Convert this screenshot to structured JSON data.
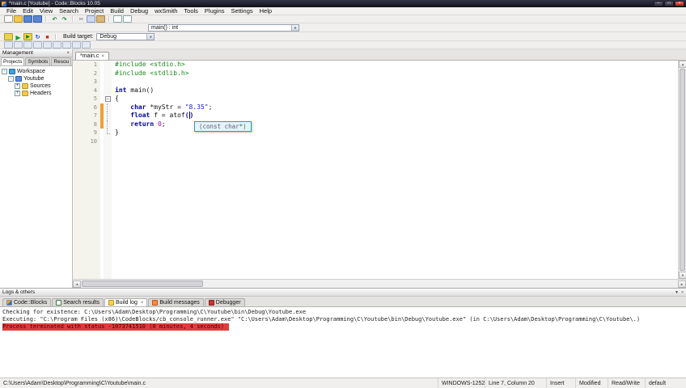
{
  "window": {
    "title": "*main.c [Youtube] - Code::Blocks 10.05"
  },
  "glyphs": {
    "minimize": "–",
    "maximize": "□",
    "close": "×",
    "close_small": "×",
    "dropdown": "▼",
    "left": "◄",
    "right": "►",
    "up": "▲",
    "down": "▼"
  },
  "menu": {
    "items": [
      "File",
      "Edit",
      "View",
      "Search",
      "Project",
      "Build",
      "Debug",
      "wxSmith",
      "Tools",
      "Plugins",
      "Settings",
      "Help"
    ]
  },
  "toolbar": {
    "row1_icons": [
      "new-file",
      "open",
      "save",
      "save-all",
      "|",
      "undo",
      "redo",
      "|",
      "cut",
      "copy",
      "paste",
      "|",
      "find",
      "replace"
    ],
    "symbol_combo": "main() : int",
    "build_icons": [
      "compile",
      "run",
      "build-and-run",
      "rebuild",
      "abort"
    ],
    "build_target_label": "Build target:",
    "build_target_value": "Debug",
    "debug_icons": [
      "debug",
      "run-to-cursor",
      "next-line",
      "step-into",
      "step-out",
      "next-instruction",
      "toggle-breakpoint",
      "debugging-windows",
      "various-info"
    ],
    "icon_glyphs": {
      "undo": "↶",
      "redo": "↷",
      "cut": "✂",
      "run": "▶",
      "build-and-run": "▶",
      "rebuild": "↻",
      "abort": "■"
    }
  },
  "management": {
    "title": "Management",
    "tabs": [
      {
        "label": "Projects",
        "active": true
      },
      {
        "label": "Symbols"
      },
      {
        "label": "Resou"
      }
    ],
    "tree": [
      {
        "label": "Workspace",
        "indent": 0,
        "expander": "-",
        "icon": "workspace"
      },
      {
        "label": "Youtube",
        "indent": 1,
        "expander": "-",
        "icon": "project"
      },
      {
        "label": "Sources",
        "indent": 2,
        "expander": "+",
        "icon": "folder"
      },
      {
        "label": "Headers",
        "indent": 2,
        "expander": "+",
        "icon": "folder"
      }
    ]
  },
  "editor": {
    "tab_label": "*main.c",
    "calltip": "(const char*)",
    "lines": [
      {
        "num": "1",
        "tokens": [
          {
            "t": "#include <stdio.h>",
            "c": "preproc"
          }
        ]
      },
      {
        "num": "2",
        "tokens": [
          {
            "t": "#include <stdlib.h>",
            "c": "preproc"
          }
        ]
      },
      {
        "num": "3",
        "tokens": []
      },
      {
        "num": "4",
        "tokens": [
          {
            "t": "int",
            "c": "keyword"
          },
          {
            "t": " main()",
            "c": "plain"
          }
        ]
      },
      {
        "num": "5",
        "fold": "minus",
        "tokens": [
          {
            "t": "{",
            "c": "plain"
          }
        ]
      },
      {
        "num": "6",
        "guide": "mid",
        "changed": true,
        "tokens": [
          {
            "t": "    ",
            "c": "plain"
          },
          {
            "t": "char",
            "c": "keyword"
          },
          {
            "t": " *myStr = ",
            "c": "plain"
          },
          {
            "t": "\"8.35\"",
            "c": "string"
          },
          {
            "t": ";",
            "c": "plain"
          }
        ]
      },
      {
        "num": "7",
        "guide": "mid",
        "changed": true,
        "tokens": [
          {
            "t": "    ",
            "c": "plain"
          },
          {
            "t": "float",
            "c": "keyword"
          },
          {
            "t": " f = atof",
            "c": "plain"
          },
          {
            "t": "(",
            "c": "brace"
          },
          {
            "t": "",
            "c": "cursor"
          },
          {
            "t": ")",
            "c": "brace"
          }
        ]
      },
      {
        "num": "8",
        "guide": "mid",
        "changed": true,
        "tokens": [
          {
            "t": "    ",
            "c": "plain"
          },
          {
            "t": "return",
            "c": "keyword"
          },
          {
            "t": " ",
            "c": "plain"
          },
          {
            "t": "0",
            "c": "number"
          },
          {
            "t": ";",
            "c": "plain"
          }
        ]
      },
      {
        "num": "9",
        "guide": "end",
        "tokens": [
          {
            "t": "}",
            "c": "plain"
          }
        ]
      },
      {
        "num": "10",
        "tokens": []
      }
    ]
  },
  "logs": {
    "title": "Logs & others",
    "tabs": [
      {
        "label": "Code::Blocks",
        "icon": "codeblocks"
      },
      {
        "label": "Search results",
        "icon": "search"
      },
      {
        "label": "Build log",
        "icon": "build-log",
        "active": true,
        "closable": true
      },
      {
        "label": "Build messages",
        "icon": "build-messages"
      },
      {
        "label": "Debugger",
        "icon": "debugger"
      }
    ],
    "lines": [
      {
        "style": "normal",
        "text": "Checking for existence: C:\\Users\\Adam\\Desktop\\Programming\\C\\Youtube\\bin\\Debug\\Youtube.exe"
      },
      {
        "style": "normal",
        "text": "Executing: \"C:\\Program Files (x86)\\CodeBlocks/cb_console_runner.exe\" \"C:\\Users\\Adam\\Desktop\\Programming\\C\\Youtube\\bin\\Debug\\Youtube.exe\"  (in C:\\Users\\Adam\\Desktop\\Programming\\C\\Youtube\\.)"
      },
      {
        "style": "error",
        "text": "Process terminated with status -1073741510 (0 minutes, 4 seconds)"
      }
    ]
  },
  "statusbar": {
    "fields": [
      {
        "name": "file-path",
        "text": "C:\\Users\\Adam\\Desktop\\Programming\\C\\Youtube\\main.c"
      },
      {
        "name": "encoding",
        "text": "WINDOWS-1252"
      },
      {
        "name": "caret-position",
        "text": "Line 7, Column 20"
      },
      {
        "name": "insert-mode",
        "text": "Insert"
      },
      {
        "name": "modified-state",
        "text": "Modified"
      },
      {
        "name": "readwrite-state",
        "text": "Read/Write"
      },
      {
        "name": "profile",
        "text": "default"
      }
    ]
  }
}
